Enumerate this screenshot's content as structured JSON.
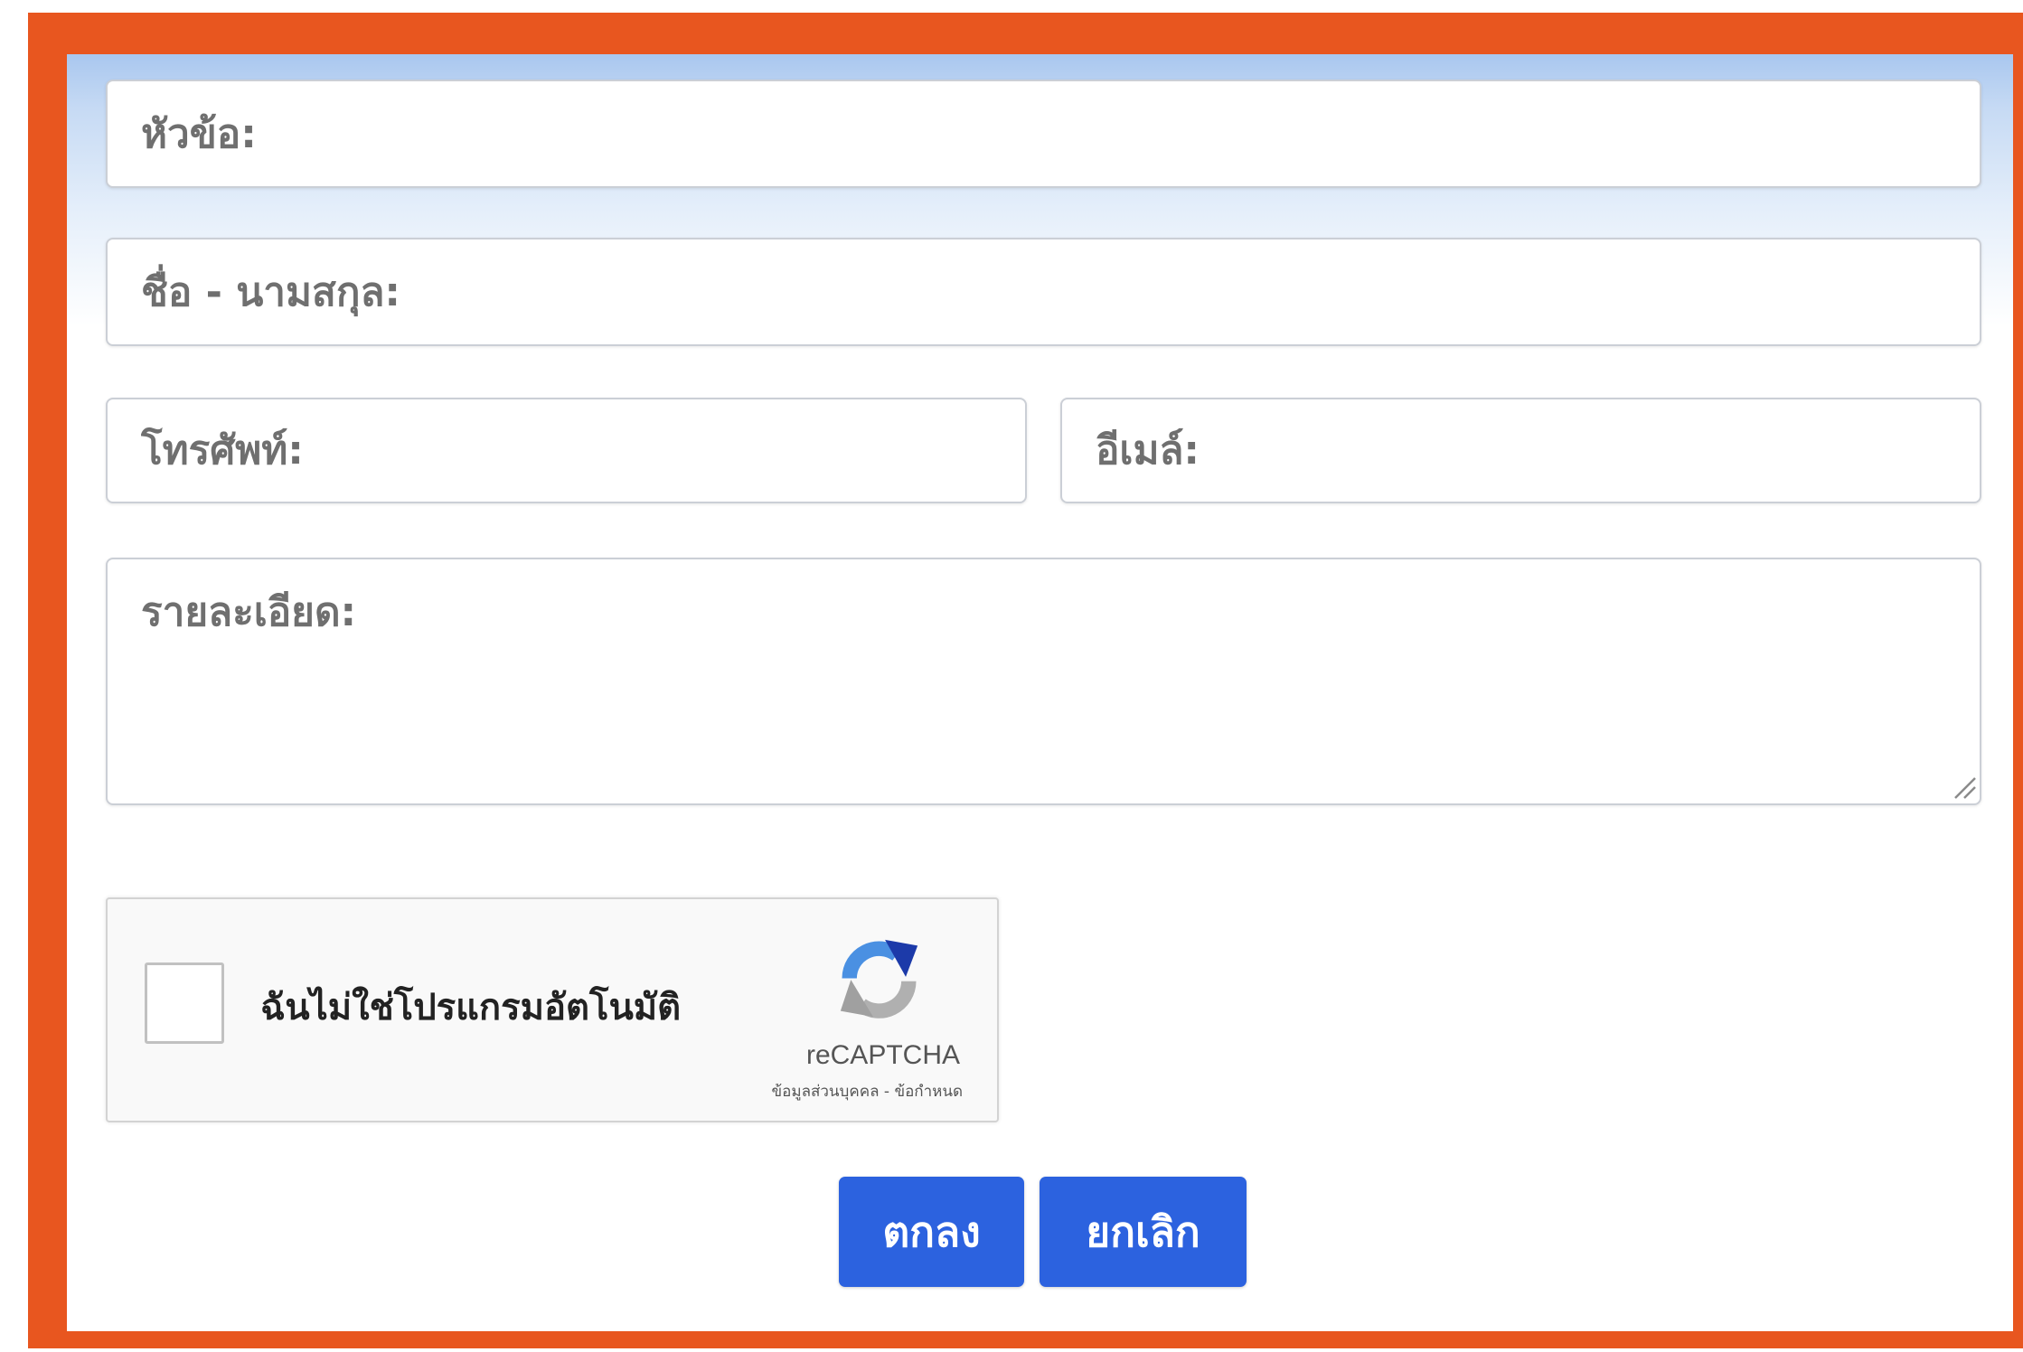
{
  "form": {
    "subject": {
      "placeholder": "หัวข้อ:"
    },
    "fullname": {
      "placeholder": "ชื่อ - นามสกุล:"
    },
    "phone": {
      "placeholder": "โทรศัพท์:"
    },
    "email": {
      "placeholder": "อีเมล์:"
    },
    "details": {
      "placeholder": "รายละเอียด:",
      "value": ""
    }
  },
  "recaptcha": {
    "checkbox_label": "ฉันไม่ใช่โปรแกรมอัตโนมัติ",
    "checked": false,
    "brand": "reCAPTCHA",
    "privacy_label": "ข้อมูลส่วนบุคคล",
    "separator": "-",
    "terms_label": "ข้อกำหนด",
    "logo_icon": "recaptcha-logo-icon"
  },
  "buttons": {
    "submit_label": "ตกลง",
    "cancel_label": "ยกเลิก"
  },
  "colors": {
    "frame": "#e8561f",
    "header_gradient": "#a9c7ef",
    "button": "#2c62df"
  }
}
